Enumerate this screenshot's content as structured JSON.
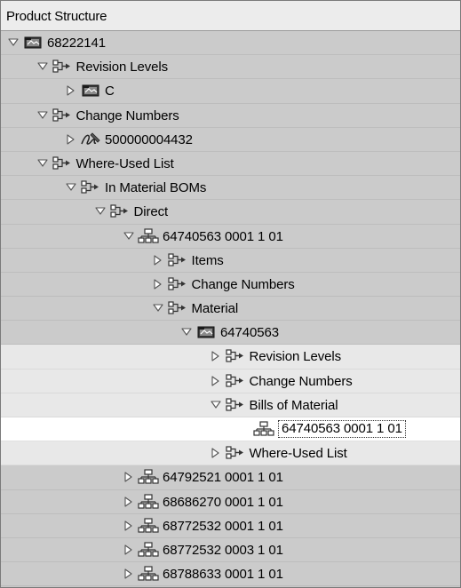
{
  "header": {
    "title": "Product Structure"
  },
  "tree": [
    {
      "level": 0,
      "state": "expanded",
      "icon": "material-icon",
      "label": "68222141",
      "bg": "dark"
    },
    {
      "level": 1,
      "state": "expanded",
      "icon": "folder-link-icon",
      "label": "Revision Levels",
      "bg": "dark"
    },
    {
      "level": 2,
      "state": "collapsed",
      "icon": "material-icon",
      "label": "C",
      "bg": "dark"
    },
    {
      "level": 1,
      "state": "expanded",
      "icon": "folder-link-icon",
      "label": "Change Numbers",
      "bg": "dark"
    },
    {
      "level": 2,
      "state": "collapsed",
      "icon": "signature-icon",
      "label": "500000004432",
      "bg": "dark"
    },
    {
      "level": 1,
      "state": "expanded",
      "icon": "folder-link-icon",
      "label": "Where-Used List",
      "bg": "dark"
    },
    {
      "level": 2,
      "state": "expanded",
      "icon": "folder-link-icon",
      "label": "In Material BOMs",
      "bg": "dark"
    },
    {
      "level": 3,
      "state": "expanded",
      "icon": "folder-link-icon",
      "label": "Direct",
      "bg": "dark"
    },
    {
      "level": 4,
      "state": "expanded",
      "icon": "bom-icon",
      "label": "64740563 0001 1 01",
      "bg": "dark"
    },
    {
      "level": 5,
      "state": "collapsed",
      "icon": "folder-link-icon",
      "label": "Items",
      "bg": "dark"
    },
    {
      "level": 5,
      "state": "collapsed",
      "icon": "folder-link-icon",
      "label": "Change Numbers",
      "bg": "dark"
    },
    {
      "level": 5,
      "state": "expanded",
      "icon": "folder-link-icon",
      "label": "Material",
      "bg": "dark"
    },
    {
      "level": 6,
      "state": "expanded",
      "icon": "material-icon",
      "label": "64740563",
      "bg": "dark"
    },
    {
      "level": 7,
      "state": "collapsed",
      "icon": "folder-link-icon",
      "label": "Revision Levels",
      "bg": "light"
    },
    {
      "level": 7,
      "state": "collapsed",
      "icon": "folder-link-icon",
      "label": "Change Numbers",
      "bg": "light"
    },
    {
      "level": 7,
      "state": "expanded",
      "icon": "folder-link-icon",
      "label": "Bills of Material",
      "bg": "light"
    },
    {
      "level": 8,
      "state": "leaf",
      "icon": "bom-icon",
      "label": "64740563 0001 1 01",
      "bg": "selected"
    },
    {
      "level": 7,
      "state": "collapsed",
      "icon": "folder-link-icon",
      "label": "Where-Used List",
      "bg": "light"
    },
    {
      "level": 4,
      "state": "collapsed",
      "icon": "bom-icon",
      "label": "64792521 0001 1 01",
      "bg": "dark"
    },
    {
      "level": 4,
      "state": "collapsed",
      "icon": "bom-icon",
      "label": "68686270 0001 1 01",
      "bg": "dark"
    },
    {
      "level": 4,
      "state": "collapsed",
      "icon": "bom-icon",
      "label": "68772532 0001 1 01",
      "bg": "dark"
    },
    {
      "level": 4,
      "state": "collapsed",
      "icon": "bom-icon",
      "label": "68772532 0003 1 01",
      "bg": "dark"
    },
    {
      "level": 4,
      "state": "collapsed",
      "icon": "bom-icon",
      "label": "68788633 0001 1 01",
      "bg": "dark"
    }
  ]
}
